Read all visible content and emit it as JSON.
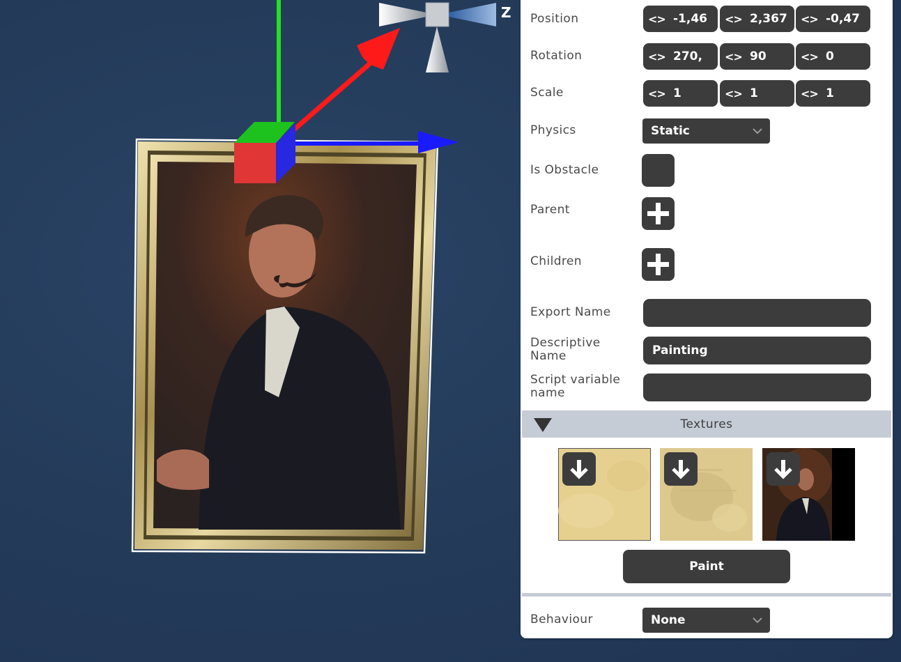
{
  "viewport": {
    "axis_label_z": "Z",
    "colors": {
      "x_axis": "#ff1a1a",
      "y_axis": "#22e022",
      "z_axis": "#1a1aff",
      "background": "#253d5b"
    }
  },
  "inspector": {
    "position": {
      "label": "Position",
      "x": "-1,46",
      "y": "2,367",
      "z": "-0,47"
    },
    "rotation": {
      "label": "Rotation",
      "x": "270,",
      "y": "90",
      "z": "0"
    },
    "scale": {
      "label": "Scale",
      "x": "1",
      "y": "1",
      "z": "1"
    },
    "physics": {
      "label": "Physics",
      "value": "Static"
    },
    "is_obstacle": {
      "label": "Is Obstacle",
      "checked": false
    },
    "parent": {
      "label": "Parent"
    },
    "children": {
      "label": "Children"
    },
    "export_name": {
      "label": "Export Name",
      "value": ""
    },
    "descriptive_name": {
      "label_line1": "Descriptive",
      "label_line2": "Name",
      "value": "Painting"
    },
    "script_variable_name": {
      "label_line1": "Script variable",
      "label_line2": "name",
      "value": ""
    },
    "textures": {
      "title": "Textures",
      "items": [
        {
          "name": "paper-texture-1",
          "icon": "download-icon"
        },
        {
          "name": "paper-texture-2",
          "icon": "download-icon"
        },
        {
          "name": "portrait-texture",
          "icon": "download-icon"
        }
      ],
      "paint_label": "Paint"
    },
    "behaviour": {
      "label": "Behaviour",
      "value": "None"
    },
    "colors": {
      "field_bg": "#3c3c3c",
      "section_header": "#c5ccd6"
    }
  }
}
